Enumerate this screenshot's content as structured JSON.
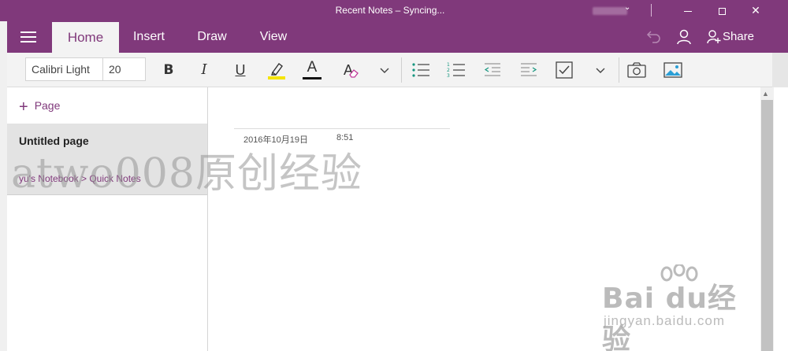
{
  "window": {
    "title": "Recent Notes – Syncing...",
    "controls": {
      "minimize": "minimize",
      "maximize": "maximize",
      "close": "✕"
    }
  },
  "tabs": [
    {
      "label": "Home",
      "active": true
    },
    {
      "label": "Insert",
      "active": false
    },
    {
      "label": "Draw",
      "active": false
    },
    {
      "label": "View",
      "active": false
    }
  ],
  "header_actions": {
    "share_label": "Share"
  },
  "ribbon": {
    "font_name": "Calibri Light",
    "font_size": "20",
    "bold": "B",
    "italic": "I",
    "underline": "U",
    "font_color": "A",
    "clear_format": "A",
    "more": "⌄"
  },
  "sidebar": {
    "add_page_label": "Page",
    "pages": [
      {
        "title": "Untitled page",
        "path": "yu's Notebook > Quick Notes"
      }
    ]
  },
  "note": {
    "date": "2016年10月19日",
    "time": "8:51"
  },
  "watermarks": {
    "left": "atwo008原创经验",
    "right_brand": "Bai du经验",
    "right_url": "jingyan.baidu.com"
  },
  "colors": {
    "accent": "#80397b",
    "highlight": "#f5e400",
    "ribbon_bg": "#f3f3f3"
  },
  "icons": [
    "hamburger-icon",
    "undo-icon",
    "user-icon",
    "share-icon",
    "highlighter-icon",
    "eraser-icon",
    "bullets-icon",
    "numbering-icon",
    "outdent-icon",
    "indent-icon",
    "todo-checkbox-icon",
    "camera-icon",
    "picture-icon",
    "plus-icon"
  ]
}
